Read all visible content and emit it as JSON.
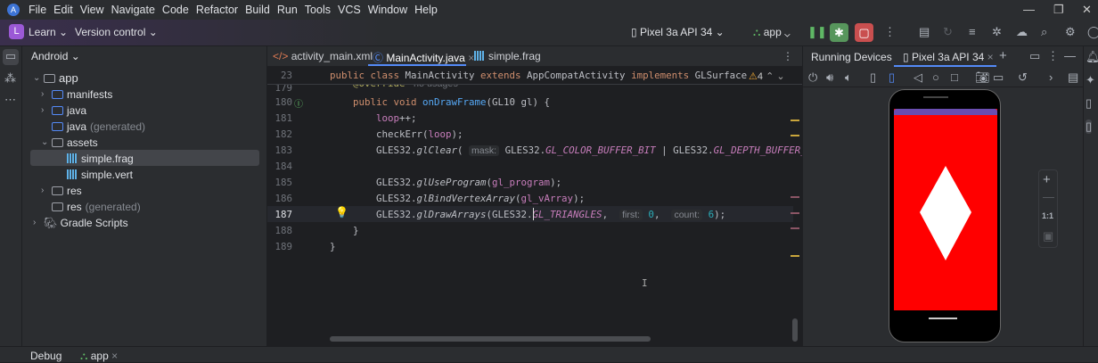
{
  "menu": [
    "File",
    "Edit",
    "View",
    "Navigate",
    "Code",
    "Refactor",
    "Build",
    "Run",
    "Tools",
    "VCS",
    "Window",
    "Help"
  ],
  "toolbar": {
    "project_initial": "L",
    "project": "Learn",
    "vcs": "Version control",
    "device": "Pixel 3a API 34",
    "run_config": "app"
  },
  "project_panel": {
    "title": "Android",
    "items": [
      {
        "label": "app",
        "suffix": ""
      },
      {
        "label": "manifests",
        "suffix": ""
      },
      {
        "label": "java",
        "suffix": ""
      },
      {
        "label": "java",
        "suffix": "(generated)"
      },
      {
        "label": "assets",
        "suffix": ""
      },
      {
        "label": "simple.frag",
        "suffix": ""
      },
      {
        "label": "simple.vert",
        "suffix": ""
      },
      {
        "label": "res",
        "suffix": ""
      },
      {
        "label": "res",
        "suffix": "(generated)"
      },
      {
        "label": "Gradle Scripts",
        "suffix": ""
      }
    ]
  },
  "editor": {
    "tabs": [
      "activity_main.xml",
      "MainActivity.java",
      "simple.frag"
    ],
    "active_tab": "MainActivity.java",
    "warnings": "4",
    "lines": [
      {
        "n": "23",
        "tokens": [
          [
            "k",
            "public class "
          ],
          [
            "",
            "MainActivity "
          ],
          [
            "k",
            "extends "
          ],
          [
            "",
            "AppCompatActivity "
          ],
          [
            "k",
            "implements "
          ],
          [
            "",
            "GLSurface"
          ]
        ]
      },
      {
        "n": "179",
        "tokens": [
          [
            "ann",
            "    @Override "
          ],
          [
            "gr",
            " no usages"
          ]
        ]
      },
      {
        "n": "180",
        "tokens": [
          [
            "k",
            "    public void "
          ],
          [
            "f",
            "onDrawFrame"
          ],
          [
            "",
            "(GL10 gl) {"
          ]
        ]
      },
      {
        "n": "181",
        "tokens": [
          [
            "p",
            "        loop"
          ],
          [
            "",
            "++;"
          ]
        ]
      },
      {
        "n": "182",
        "tokens": [
          [
            "",
            "        checkErr("
          ],
          [
            "p",
            "loop"
          ],
          [
            "",
            ");"
          ]
        ]
      },
      {
        "n": "183",
        "tokens": [
          [
            "",
            "        GLES32."
          ],
          [
            "it",
            "glClear"
          ],
          [
            "",
            "( "
          ],
          [
            "hint",
            "mask:"
          ],
          [
            "",
            " GLES32."
          ],
          [
            "cs",
            "GL_COLOR_BUFFER_BIT"
          ],
          [
            "",
            " | GLES32."
          ],
          [
            "cs",
            "GL_DEPTH_BUFFER_BIT"
          ]
        ]
      },
      {
        "n": "184",
        "tokens": []
      },
      {
        "n": "185",
        "tokens": [
          [
            "",
            "        GLES32."
          ],
          [
            "it",
            "glUseProgram"
          ],
          [
            "",
            "("
          ],
          [
            "p",
            "gl_program"
          ],
          [
            "",
            ");"
          ]
        ]
      },
      {
        "n": "186",
        "tokens": [
          [
            "",
            "        GLES32."
          ],
          [
            "it",
            "glBindVertexArray"
          ],
          [
            "",
            "("
          ],
          [
            "p",
            "gl_vArray"
          ],
          [
            "",
            ");"
          ]
        ]
      },
      {
        "n": "187",
        "tokens": [
          [
            "",
            "        GLES32."
          ],
          [
            "it",
            "glDrawArrays"
          ],
          [
            "",
            "(GLES32."
          ],
          [
            "cs",
            "GL_TRIANGLES"
          ],
          [
            "",
            ",  "
          ],
          [
            "hint",
            "first:"
          ],
          [
            "num",
            " 0"
          ],
          [
            "",
            ",  "
          ],
          [
            "hint",
            "count:"
          ],
          [
            "num",
            " 6"
          ],
          [
            "",
            ");"
          ]
        ]
      },
      {
        "n": "188",
        "tokens": [
          [
            "",
            "    }"
          ]
        ]
      },
      {
        "n": "189",
        "tokens": [
          [
            "",
            "}"
          ]
        ]
      }
    ]
  },
  "devices": {
    "title": "Running Devices",
    "tab": "Pixel 3a API 34",
    "zoom_reset": "1:1"
  },
  "status": {
    "debug": "Debug",
    "session": "app"
  },
  "colors": {
    "screen": "#ff0000",
    "shape": "#ffffff",
    "accent": "#548af7"
  }
}
